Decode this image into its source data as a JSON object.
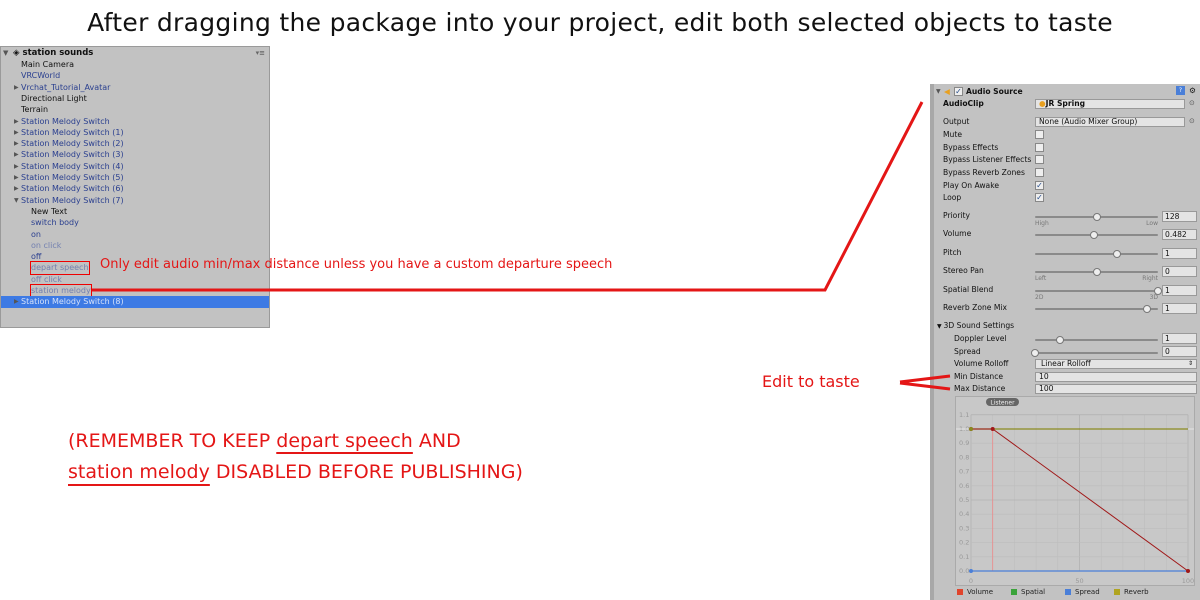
{
  "title": "After dragging the package into your project, edit both selected objects to taste",
  "hierarchy": {
    "scene": "station sounds",
    "items": [
      {
        "label": "Main Camera",
        "indent": 0,
        "arrow": "",
        "color": "black"
      },
      {
        "label": "VRCWorld",
        "indent": 0,
        "arrow": "",
        "color": "blue"
      },
      {
        "label": "Vrchat_Tutorial_Avatar",
        "indent": 0,
        "arrow": "right",
        "color": "blue"
      },
      {
        "label": "Directional Light",
        "indent": 0,
        "arrow": "",
        "color": "black"
      },
      {
        "label": "Terrain",
        "indent": 0,
        "arrow": "",
        "color": "black"
      },
      {
        "label": "Station Melody Switch",
        "indent": 0,
        "arrow": "right",
        "color": "blue"
      },
      {
        "label": "Station Melody Switch (1)",
        "indent": 0,
        "arrow": "right",
        "color": "blue"
      },
      {
        "label": "Station Melody Switch (2)",
        "indent": 0,
        "arrow": "right",
        "color": "blue"
      },
      {
        "label": "Station Melody Switch (3)",
        "indent": 0,
        "arrow": "right",
        "color": "blue"
      },
      {
        "label": "Station Melody Switch (4)",
        "indent": 0,
        "arrow": "right",
        "color": "blue"
      },
      {
        "label": "Station Melody Switch (5)",
        "indent": 0,
        "arrow": "right",
        "color": "blue"
      },
      {
        "label": "Station Melody Switch (6)",
        "indent": 0,
        "arrow": "right",
        "color": "blue"
      },
      {
        "label": "Station Melody Switch (7)",
        "indent": 0,
        "arrow": "down",
        "color": "blue"
      },
      {
        "label": "New Text",
        "indent": 1,
        "arrow": "",
        "color": "black"
      },
      {
        "label": "switch body",
        "indent": 1,
        "arrow": "",
        "color": "blue"
      },
      {
        "label": "on",
        "indent": 1,
        "arrow": "",
        "color": "blue"
      },
      {
        "label": "on click",
        "indent": 1,
        "arrow": "",
        "color": "light"
      },
      {
        "label": "off",
        "indent": 1,
        "arrow": "",
        "color": "blue"
      },
      {
        "label": "depart speech",
        "indent": 1,
        "arrow": "",
        "color": "light",
        "highlight": true
      },
      {
        "label": "off click",
        "indent": 1,
        "arrow": "",
        "color": "light"
      },
      {
        "label": "station melody",
        "indent": 1,
        "arrow": "",
        "color": "light",
        "highlight": true
      },
      {
        "label": "Station Melody Switch (8)",
        "indent": 0,
        "arrow": "right",
        "color": "blue",
        "selected": true
      }
    ]
  },
  "annotations": {
    "hierarchy_note": "Only edit audio min/max distance unless you have a custom departure speech",
    "edit_note": "Edit to taste",
    "reminder_line1_pre": "(REMEMBER TO KEEP ",
    "reminder_line1_u": "depart speech",
    "reminder_line1_post": " AND",
    "reminder_line2_u": "station melody",
    "reminder_line2_post": " DISABLED BEFORE PUBLISHING)",
    "color": "#e41616"
  },
  "inspector": {
    "component": "Audio Source",
    "enabled": true,
    "audioclip_label": "AudioClip",
    "audioclip": "JR Spring",
    "output_label": "Output",
    "output": "None (Audio Mixer Group)",
    "checks": [
      {
        "label": "Mute",
        "checked": false
      },
      {
        "label": "Bypass Effects",
        "checked": false
      },
      {
        "label": "Bypass Listener Effects",
        "checked": false
      },
      {
        "label": "Bypass Reverb Zones",
        "checked": false
      },
      {
        "label": "Play On Awake",
        "checked": true
      },
      {
        "label": "Loop",
        "checked": true
      }
    ],
    "sliders": [
      {
        "label": "Priority",
        "value": "128",
        "fraction": 0.5,
        "min_label": "High",
        "max_label": "Low"
      },
      {
        "label": "Volume",
        "value": "0.482",
        "fraction": 0.482
      },
      {
        "label": "Pitch",
        "value": "1",
        "fraction": 0.667
      },
      {
        "label": "Stereo Pan",
        "value": "0",
        "fraction": 0.5,
        "min_label": "Left",
        "max_label": "Right"
      },
      {
        "label": "Spatial Blend",
        "value": "1",
        "fraction": 1,
        "min_label": "2D",
        "max_label": "3D"
      },
      {
        "label": "Reverb Zone Mix",
        "value": "1",
        "fraction": 0.91
      }
    ],
    "sound3d": {
      "header": "3D Sound Settings",
      "doppler": {
        "label": "Doppler Level",
        "value": "1",
        "fraction": 0.2
      },
      "spread": {
        "label": "Spread",
        "value": "0",
        "fraction": 0
      },
      "rolloff_label": "Volume Rolloff",
      "rolloff": "Linear Rolloff",
      "min_label": "Min Distance",
      "min": "10",
      "max_label": "Max Distance",
      "max": "100"
    },
    "graph": {
      "listener": "Listener",
      "y_ticks": [
        "1.1",
        "1.0",
        "0.9",
        "0.8",
        "0.7",
        "0.6",
        "0.5",
        "0.4",
        "0.3",
        "0.2",
        "0.1",
        "0.0"
      ],
      "x_ticks": [
        "0",
        "50",
        "100"
      ],
      "volume": [
        [
          0,
          1
        ],
        [
          10,
          1
        ],
        [
          100,
          0
        ]
      ],
      "spread": [
        [
          0,
          0
        ],
        [
          100,
          0
        ]
      ],
      "reverb": [
        [
          0,
          1
        ],
        [
          100,
          1
        ]
      ],
      "legend": [
        {
          "label": "Volume",
          "color": "#e0442c"
        },
        {
          "label": "Spatial",
          "color": "#3aa33a"
        },
        {
          "label": "Spread",
          "color": "#4a7fd8"
        },
        {
          "label": "Reverb",
          "color": "#b0a420"
        }
      ]
    }
  }
}
